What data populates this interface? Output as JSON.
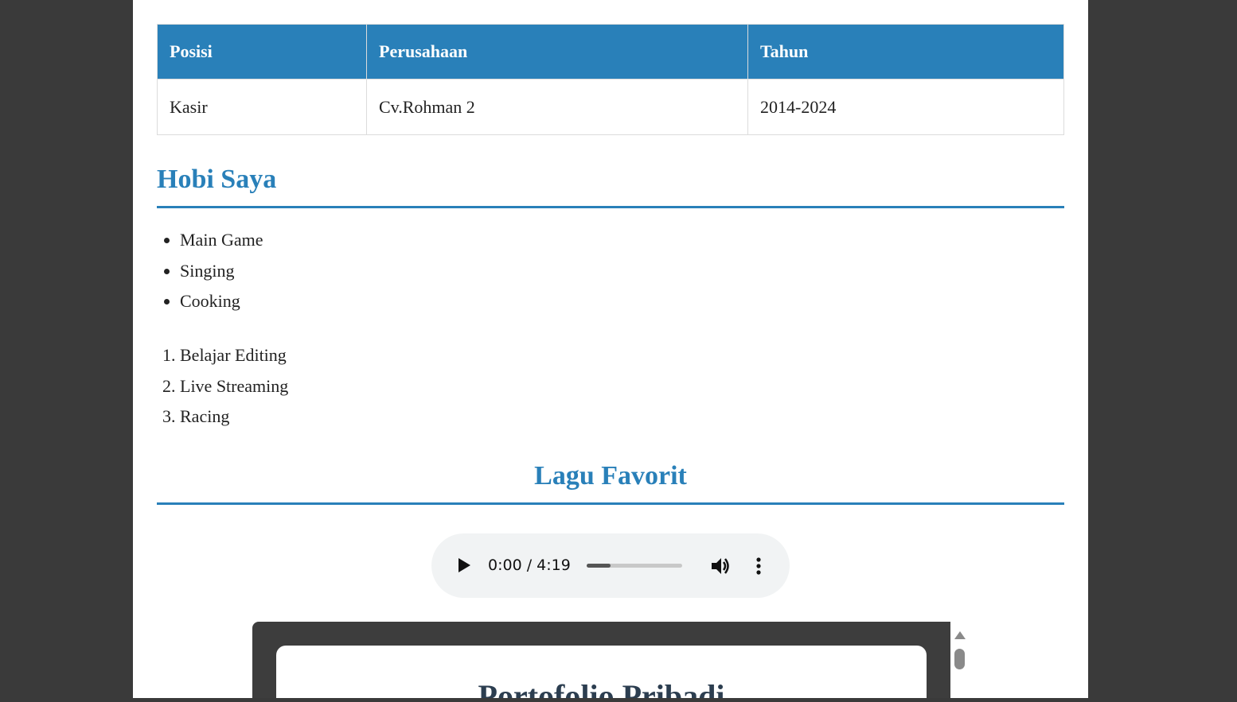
{
  "table": {
    "headers": [
      "Posisi",
      "Perusahaan",
      "Tahun"
    ],
    "rows": [
      [
        "Kasir",
        "Cv.Rohman 2",
        "2014-2024"
      ]
    ]
  },
  "hobbies": {
    "title": "Hobi Saya",
    "unordered": [
      "Main Game",
      "Singing",
      "Cooking"
    ],
    "ordered": [
      "Belajar Editing",
      "Live Streaming",
      "Racing"
    ]
  },
  "songs": {
    "title": "Lagu Favorit",
    "player": {
      "time": "0:00 / 4:19",
      "progress_fraction": 0.25
    }
  },
  "embed": {
    "title": "Portofolio Pribadi"
  },
  "colors": {
    "accent": "#2980b9",
    "page_bg": "#3a3a3a"
  }
}
